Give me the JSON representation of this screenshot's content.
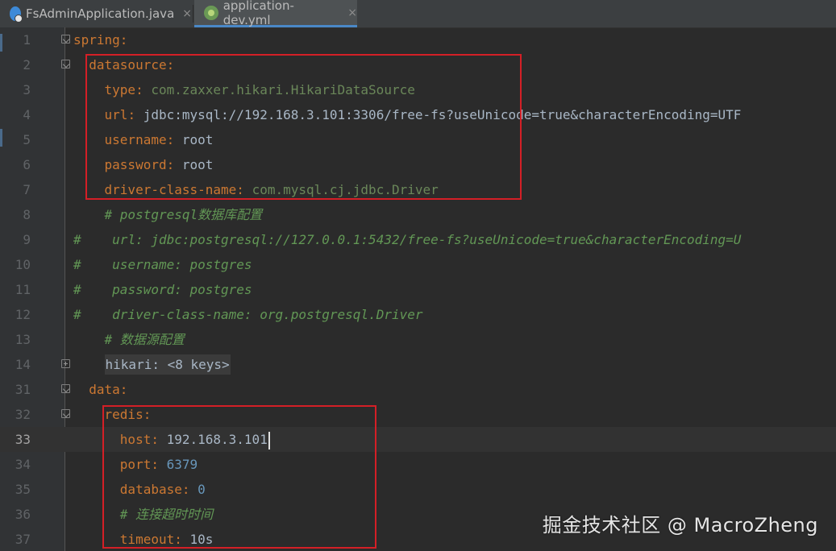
{
  "tabs": [
    {
      "label": "FsAdminApplication.java",
      "icon": "java-class-icon",
      "active": false
    },
    {
      "label": "application-dev.yml",
      "icon": "spring-yaml-icon",
      "active": true
    }
  ],
  "tab_close_glyph": "×",
  "colors": {
    "key": "#cc7832",
    "string": "#6a8759",
    "number": "#6897bb",
    "comment": "#629755",
    "highlight_box": "#d41f26"
  },
  "lines": [
    {
      "num": "1",
      "text": "spring:"
    },
    {
      "num": "2",
      "text": "datasource:"
    },
    {
      "num": "3",
      "key": "type",
      "value": "com.zaxxer.hikari.HikariDataSource"
    },
    {
      "num": "4",
      "key": "url",
      "value": "jdbc:mysql://192.168.3.101:3306/free-fs?useUnicode=true&characterEncoding=UTF"
    },
    {
      "num": "5",
      "key": "username",
      "value": "root"
    },
    {
      "num": "6",
      "key": "password",
      "value": "root"
    },
    {
      "num": "7",
      "key": "driver-class-name",
      "value": "com.mysql.cj.jdbc.Driver"
    },
    {
      "num": "8",
      "text": "# postgresql数据库配置"
    },
    {
      "num": "9",
      "hash": "#",
      "text": "url: jdbc:postgresql://127.0.0.1:5432/free-fs?useUnicode=true&characterEncoding=U"
    },
    {
      "num": "10",
      "hash": "#",
      "text": "username: postgres"
    },
    {
      "num": "11",
      "hash": "#",
      "text": "password: postgres"
    },
    {
      "num": "12",
      "hash": "#",
      "text": "driver-class-name: org.postgresql.Driver"
    },
    {
      "num": "13",
      "text": "# 数据源配置"
    },
    {
      "num": "14",
      "text": "hikari: <8 keys>"
    },
    {
      "num": "31",
      "text": "data:"
    },
    {
      "num": "32",
      "text": "redis:"
    },
    {
      "num": "33",
      "key": "host",
      "value": "192.168.3.101"
    },
    {
      "num": "34",
      "key": "port",
      "value": "6379"
    },
    {
      "num": "35",
      "key": "database",
      "value": "0"
    },
    {
      "num": "36",
      "text": "# 连接超时时间"
    },
    {
      "num": "37",
      "key": "timeout",
      "value": "10s"
    }
  ],
  "watermark": "掘金技术社区 @ MacroZheng"
}
